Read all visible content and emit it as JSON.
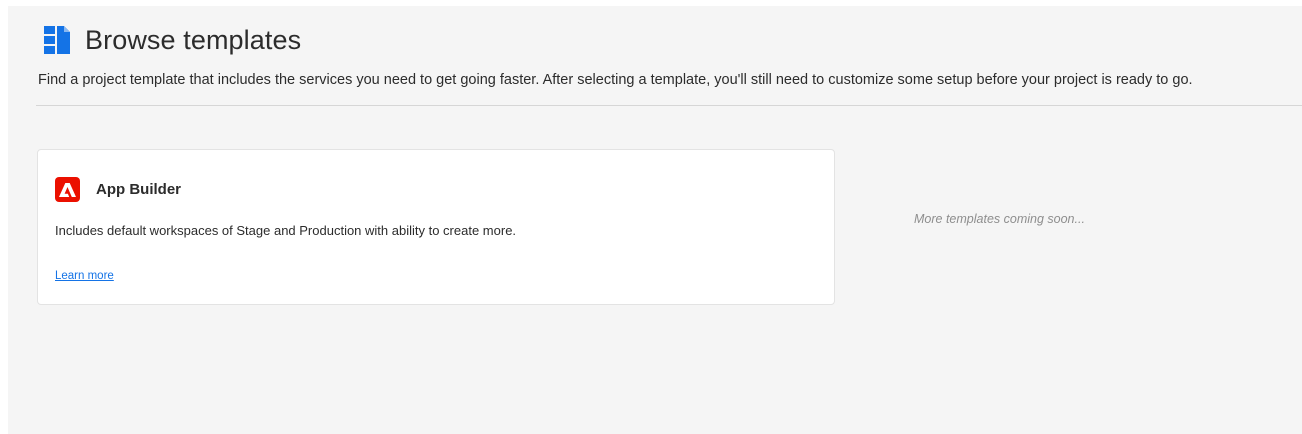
{
  "header": {
    "title": "Browse templates",
    "description": "Find a project template that includes the services you need to get going faster. After selecting a template, you'll still need to customize some setup before your project is ready to go.",
    "icon": "template-icon"
  },
  "templates": [
    {
      "title": "App Builder",
      "description": "Includes default workspaces of Stage and Production with ability to create more.",
      "link_label": "Learn more",
      "icon": "adobe-logo-icon"
    }
  ],
  "placeholder": {
    "text": "More templates coming soon..."
  },
  "colors": {
    "accent": "#1473e6",
    "brand": "#eb1000",
    "icon_blue": "#1473e6",
    "background": "#f5f5f5"
  }
}
